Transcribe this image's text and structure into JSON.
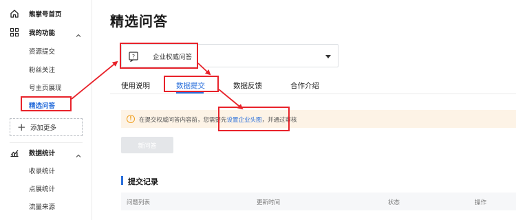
{
  "sidebar": {
    "home_label": "熊掌号首页",
    "my_functions": {
      "label": "我的功能",
      "items": [
        "资源提交",
        "粉丝关注",
        "号主页展现",
        "精选问答"
      ]
    },
    "add_more_label": "添加更多",
    "data_stats": {
      "label": "数据统计",
      "items": [
        "收录统计",
        "点展统计",
        "流量来源"
      ]
    }
  },
  "main": {
    "title": "精选问答",
    "selector_value": "企业权威问答",
    "tabs": [
      "使用说明",
      "数据提交",
      "数据反馈",
      "合作介绍"
    ],
    "notice": {
      "before": "在提交权威问答内容前，您需要先",
      "link": "设置企业头图",
      "after": "，并通过审核"
    },
    "new_button": "新问答",
    "records_title": "提交记录",
    "table_columns": [
      "问题列表",
      "更新时间",
      "状态",
      "操作"
    ]
  },
  "colors": {
    "accent": "#2a6fdb",
    "highlight": "#e8222a",
    "notice_bg": "#fdf3e6",
    "warn": "#f0a020"
  }
}
